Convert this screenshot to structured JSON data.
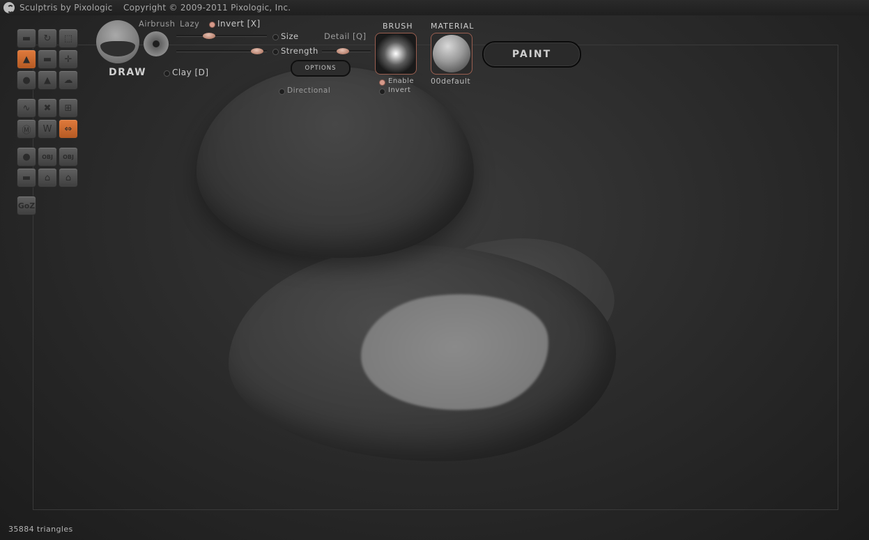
{
  "window": {
    "title": "Sculptris by Pixologic",
    "copyright": "Copyright © 2009-2011 Pixologic, Inc."
  },
  "toolbar": {
    "tools": [
      {
        "name": "crease-tool",
        "glyph": "▬",
        "active": false
      },
      {
        "name": "rotate-tool",
        "glyph": "↻",
        "active": false
      },
      {
        "name": "scale-tool",
        "glyph": "⬚",
        "active": false
      },
      {
        "name": "draw-tool",
        "glyph": "▲",
        "active": true
      },
      {
        "name": "flatten-tool",
        "glyph": "▬",
        "active": false
      },
      {
        "name": "grab-tool",
        "glyph": "✛",
        "active": false
      },
      {
        "name": "inflate-tool",
        "glyph": "●",
        "active": false
      },
      {
        "name": "pinch-tool",
        "glyph": "▲",
        "active": false
      },
      {
        "name": "smooth-tool",
        "glyph": "☁",
        "active": false
      },
      {
        "name": "reduce-brush-tool",
        "glyph": "∿",
        "active": false
      },
      {
        "name": "reduce-selected-tool",
        "glyph": "✖",
        "active": false
      },
      {
        "name": "grid-tool",
        "glyph": "⊞",
        "active": false
      },
      {
        "name": "mask-tool",
        "glyph": "M",
        "active": false
      },
      {
        "name": "wireframe-tool",
        "glyph": "W",
        "active": false
      },
      {
        "name": "symmetry-tool",
        "glyph": "⇔",
        "active": true
      },
      {
        "name": "new-sphere-button",
        "glyph": "●",
        "active": false
      },
      {
        "name": "import-obj-button",
        "glyph": "OBJ",
        "active": false
      },
      {
        "name": "export-obj-button",
        "glyph": "OBJ",
        "active": false
      },
      {
        "name": "new-plane-button",
        "glyph": "▬",
        "active": false
      },
      {
        "name": "open-button",
        "glyph": "⌂",
        "active": false
      },
      {
        "name": "save-button",
        "glyph": "⌂",
        "active": false
      }
    ],
    "goz_label": "GoZ"
  },
  "brush_panel": {
    "mode_label": "DRAW",
    "airbrush_label": "Airbrush",
    "lazy_label": "Lazy",
    "invert_label": "Invert [X]",
    "size_label": "Size",
    "strength_label": "Strength",
    "detail_label": "Detail [Q]",
    "clay_label": "Clay [D]",
    "options_label": "OPTIONS",
    "directional_label": "Directional"
  },
  "brush": {
    "title": "BRUSH",
    "enable_label": "Enable",
    "invert_label": "Invert"
  },
  "material": {
    "title": "MATERIAL",
    "name": "00default"
  },
  "paint_button_label": "PAINT",
  "status": {
    "triangles": "35884 triangles"
  }
}
